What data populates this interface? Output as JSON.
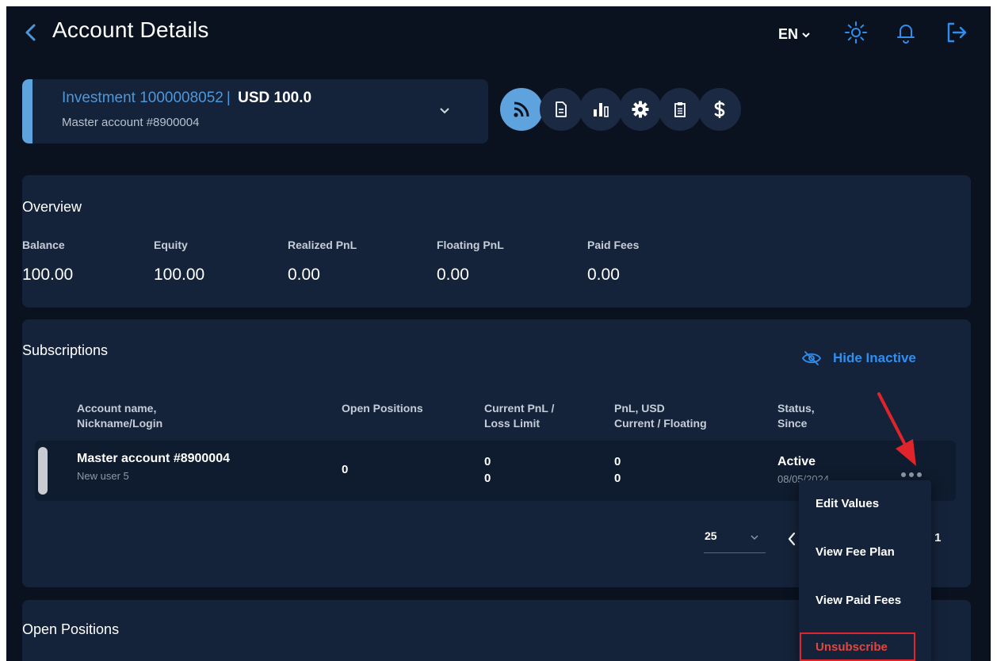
{
  "header": {
    "title": "Account Details",
    "language": "EN"
  },
  "account": {
    "name": "Investment 1000008052",
    "separator": "|",
    "balance": "USD 100.0",
    "master": "Master account #8900004"
  },
  "overview": {
    "title": "Overview",
    "stats": [
      {
        "label": "Balance",
        "value": "100.00"
      },
      {
        "label": "Equity",
        "value": "100.00"
      },
      {
        "label": "Realized PnL",
        "value": "0.00"
      },
      {
        "label": "Floating PnL",
        "value": "0.00"
      },
      {
        "label": "Paid Fees",
        "value": "0.00"
      }
    ]
  },
  "subscriptions": {
    "title": "Subscriptions",
    "hide_inactive": "Hide Inactive",
    "columns": [
      {
        "line1": "Account name,",
        "line2": "Nickname/Login"
      },
      {
        "line1": "Open Positions",
        "line2": ""
      },
      {
        "line1": "Current PnL /",
        "line2": "Loss Limit"
      },
      {
        "line1": "PnL, USD",
        "line2": "Current / Floating"
      },
      {
        "line1": "Status,",
        "line2": "Since"
      }
    ],
    "rows": [
      {
        "account": "Master account #8900004",
        "nickname": "New user 5",
        "open_positions": "0",
        "current_pnl": "0",
        "loss_limit": "0",
        "pnl_current": "0",
        "pnl_floating": "0",
        "status": "Active",
        "since": "08/05/2024"
      }
    ],
    "page_size": "25",
    "page_total": "f 1"
  },
  "row_menu": {
    "items": [
      "Edit Values",
      "View Fee Plan",
      "View Paid Fees",
      "Unsubscribe"
    ]
  },
  "open_positions": {
    "title": "Open Positions"
  },
  "colors": {
    "background": "#0a1220",
    "panel": "#15233a",
    "accent": "#5fa3de",
    "link": "#2f8ef0",
    "danger": "#e2463f",
    "annotation": "#e0242b"
  }
}
